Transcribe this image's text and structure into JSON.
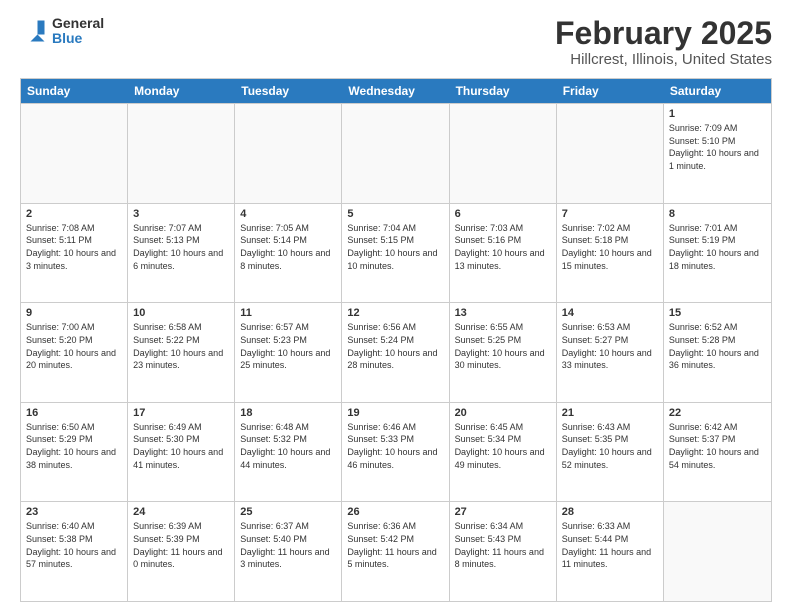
{
  "header": {
    "logo_general": "General",
    "logo_blue": "Blue",
    "title": "February 2025",
    "subtitle": "Hillcrest, Illinois, United States"
  },
  "days_of_week": [
    "Sunday",
    "Monday",
    "Tuesday",
    "Wednesday",
    "Thursday",
    "Friday",
    "Saturday"
  ],
  "weeks": [
    [
      {
        "day": "",
        "info": ""
      },
      {
        "day": "",
        "info": ""
      },
      {
        "day": "",
        "info": ""
      },
      {
        "day": "",
        "info": ""
      },
      {
        "day": "",
        "info": ""
      },
      {
        "day": "",
        "info": ""
      },
      {
        "day": "1",
        "info": "Sunrise: 7:09 AM\nSunset: 5:10 PM\nDaylight: 10 hours and 1 minute."
      }
    ],
    [
      {
        "day": "2",
        "info": "Sunrise: 7:08 AM\nSunset: 5:11 PM\nDaylight: 10 hours and 3 minutes."
      },
      {
        "day": "3",
        "info": "Sunrise: 7:07 AM\nSunset: 5:13 PM\nDaylight: 10 hours and 6 minutes."
      },
      {
        "day": "4",
        "info": "Sunrise: 7:05 AM\nSunset: 5:14 PM\nDaylight: 10 hours and 8 minutes."
      },
      {
        "day": "5",
        "info": "Sunrise: 7:04 AM\nSunset: 5:15 PM\nDaylight: 10 hours and 10 minutes."
      },
      {
        "day": "6",
        "info": "Sunrise: 7:03 AM\nSunset: 5:16 PM\nDaylight: 10 hours and 13 minutes."
      },
      {
        "day": "7",
        "info": "Sunrise: 7:02 AM\nSunset: 5:18 PM\nDaylight: 10 hours and 15 minutes."
      },
      {
        "day": "8",
        "info": "Sunrise: 7:01 AM\nSunset: 5:19 PM\nDaylight: 10 hours and 18 minutes."
      }
    ],
    [
      {
        "day": "9",
        "info": "Sunrise: 7:00 AM\nSunset: 5:20 PM\nDaylight: 10 hours and 20 minutes."
      },
      {
        "day": "10",
        "info": "Sunrise: 6:58 AM\nSunset: 5:22 PM\nDaylight: 10 hours and 23 minutes."
      },
      {
        "day": "11",
        "info": "Sunrise: 6:57 AM\nSunset: 5:23 PM\nDaylight: 10 hours and 25 minutes."
      },
      {
        "day": "12",
        "info": "Sunrise: 6:56 AM\nSunset: 5:24 PM\nDaylight: 10 hours and 28 minutes."
      },
      {
        "day": "13",
        "info": "Sunrise: 6:55 AM\nSunset: 5:25 PM\nDaylight: 10 hours and 30 minutes."
      },
      {
        "day": "14",
        "info": "Sunrise: 6:53 AM\nSunset: 5:27 PM\nDaylight: 10 hours and 33 minutes."
      },
      {
        "day": "15",
        "info": "Sunrise: 6:52 AM\nSunset: 5:28 PM\nDaylight: 10 hours and 36 minutes."
      }
    ],
    [
      {
        "day": "16",
        "info": "Sunrise: 6:50 AM\nSunset: 5:29 PM\nDaylight: 10 hours and 38 minutes."
      },
      {
        "day": "17",
        "info": "Sunrise: 6:49 AM\nSunset: 5:30 PM\nDaylight: 10 hours and 41 minutes."
      },
      {
        "day": "18",
        "info": "Sunrise: 6:48 AM\nSunset: 5:32 PM\nDaylight: 10 hours and 44 minutes."
      },
      {
        "day": "19",
        "info": "Sunrise: 6:46 AM\nSunset: 5:33 PM\nDaylight: 10 hours and 46 minutes."
      },
      {
        "day": "20",
        "info": "Sunrise: 6:45 AM\nSunset: 5:34 PM\nDaylight: 10 hours and 49 minutes."
      },
      {
        "day": "21",
        "info": "Sunrise: 6:43 AM\nSunset: 5:35 PM\nDaylight: 10 hours and 52 minutes."
      },
      {
        "day": "22",
        "info": "Sunrise: 6:42 AM\nSunset: 5:37 PM\nDaylight: 10 hours and 54 minutes."
      }
    ],
    [
      {
        "day": "23",
        "info": "Sunrise: 6:40 AM\nSunset: 5:38 PM\nDaylight: 10 hours and 57 minutes."
      },
      {
        "day": "24",
        "info": "Sunrise: 6:39 AM\nSunset: 5:39 PM\nDaylight: 11 hours and 0 minutes."
      },
      {
        "day": "25",
        "info": "Sunrise: 6:37 AM\nSunset: 5:40 PM\nDaylight: 11 hours and 3 minutes."
      },
      {
        "day": "26",
        "info": "Sunrise: 6:36 AM\nSunset: 5:42 PM\nDaylight: 11 hours and 5 minutes."
      },
      {
        "day": "27",
        "info": "Sunrise: 6:34 AM\nSunset: 5:43 PM\nDaylight: 11 hours and 8 minutes."
      },
      {
        "day": "28",
        "info": "Sunrise: 6:33 AM\nSunset: 5:44 PM\nDaylight: 11 hours and 11 minutes."
      },
      {
        "day": "",
        "info": ""
      }
    ]
  ]
}
